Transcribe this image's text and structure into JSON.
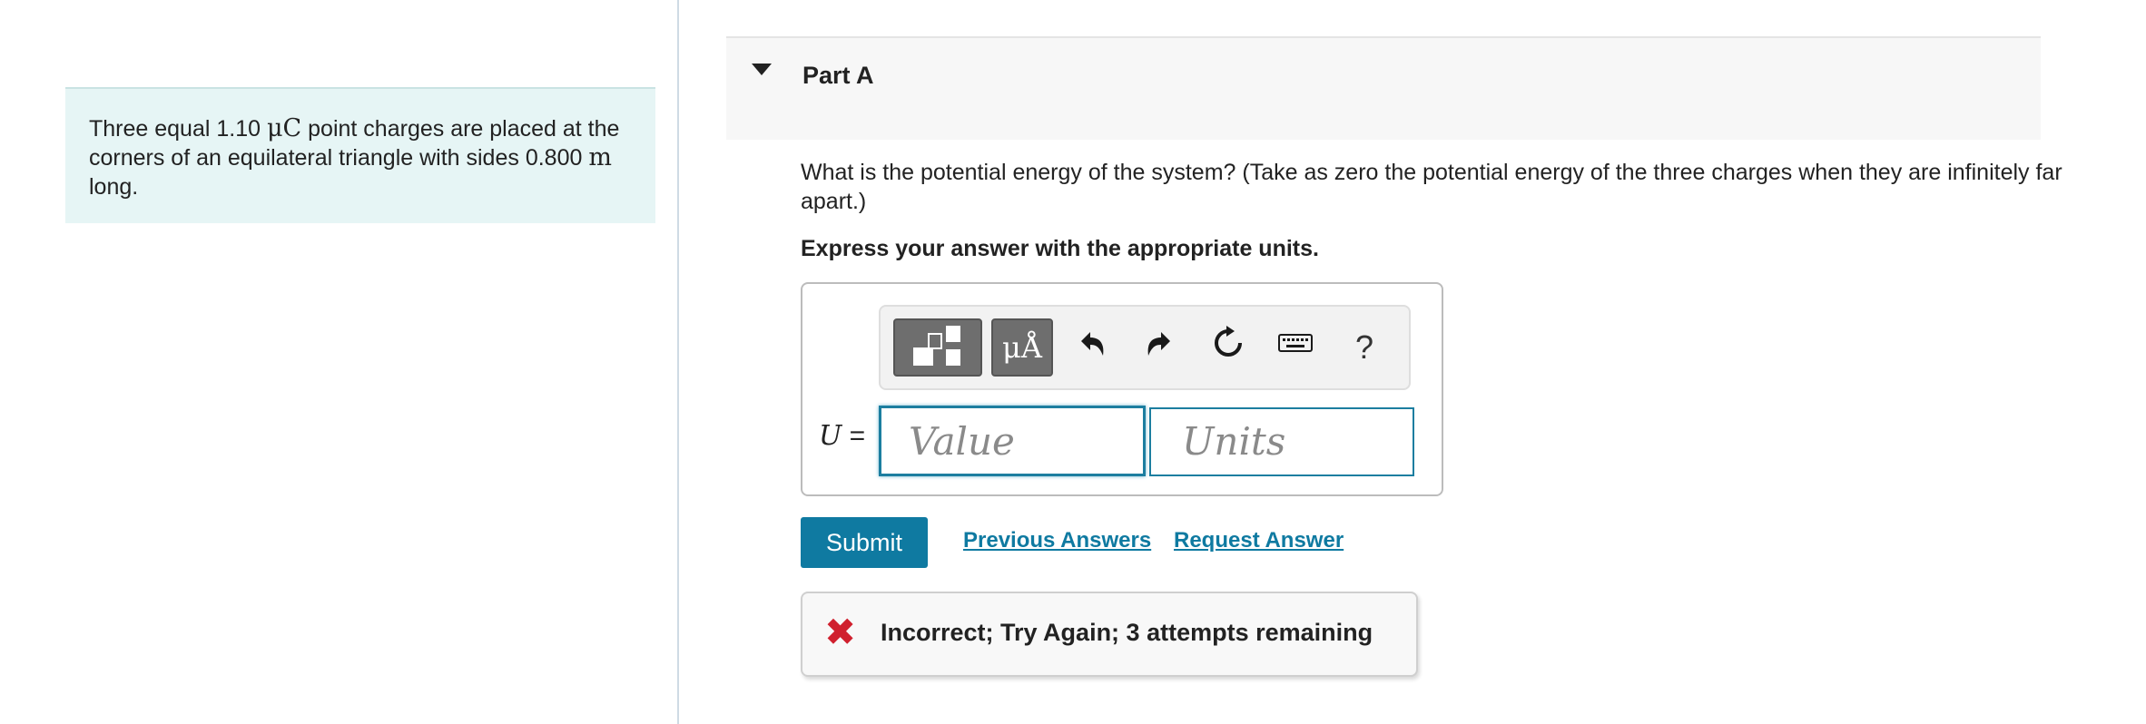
{
  "problem": {
    "text_1": "Three equal 1.10 ",
    "unit_charge": "μC",
    "text_2": " point charges are placed at the corners of an equilateral triangle with sides ",
    "side_value": "0.800",
    "unit_length": "m",
    "text_3": " long."
  },
  "part": {
    "title": "Part A",
    "question": "What is the potential energy of the system? (Take as zero the potential energy of the three charges when they are infinitely far apart.)",
    "instruction": "Express your answer with the appropriate units."
  },
  "toolbar": {
    "templates_icon": "templates-icon",
    "units_label": "μÅ",
    "undo_icon": "undo-icon",
    "redo_icon": "redo-icon",
    "reset_icon": "reset-icon",
    "keyboard_icon": "keyboard-icon",
    "help_label": "?"
  },
  "answer": {
    "variable": "U",
    "equals": " =",
    "value_placeholder": "Value",
    "units_placeholder": "Units"
  },
  "actions": {
    "submit_label": "Submit",
    "previous_answers_label": "Previous Answers",
    "request_answer_label": "Request Answer"
  },
  "feedback": {
    "icon": "x-icon",
    "message": "Incorrect; Try Again; 3 attempts remaining"
  },
  "colors": {
    "accent": "#0f7aa1",
    "problem_bg": "#e6f5f5",
    "error": "#d0202e"
  }
}
